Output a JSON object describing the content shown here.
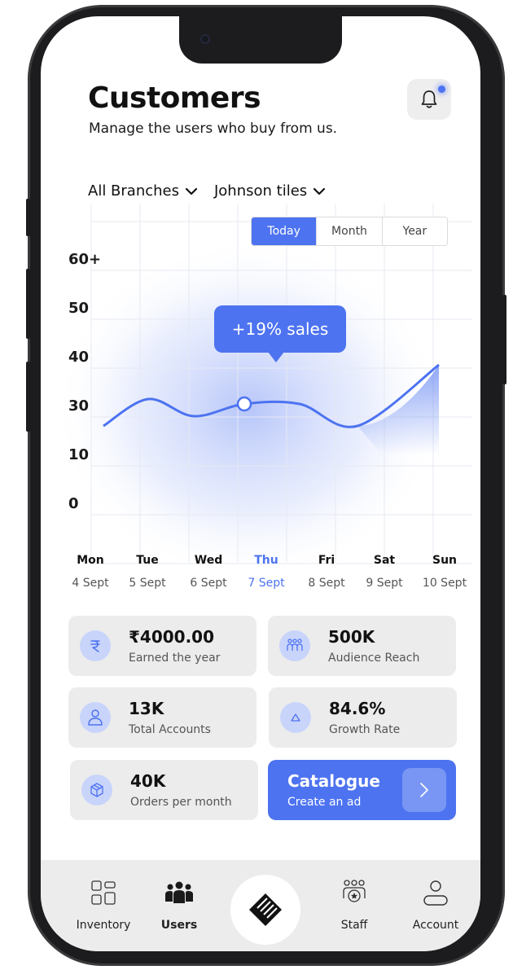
{
  "header": {
    "title": "Customers",
    "subtitle": "Manage the users who buy from us."
  },
  "filters": {
    "branch": "All Branches",
    "customer": "Johnson tiles"
  },
  "period_tabs": [
    "Today",
    "Month",
    "Year"
  ],
  "selected_period": "Today",
  "tooltip": "+19% sales",
  "chart_data": {
    "type": "line",
    "y_tick_labels": [
      "60+",
      "50",
      "40",
      "30",
      "10",
      "0"
    ],
    "x_days": [
      "Mon",
      "Tue",
      "Wed",
      "Thu",
      "Fri",
      "Sat",
      "Sun"
    ],
    "x_dates": [
      "4 Sept",
      "5 Sept",
      "6 Sept",
      "7 Sept",
      "8 Sept",
      "9 Sept",
      "10 Sept"
    ],
    "highlighted_index": 3,
    "series": [
      {
        "values": [
          25,
          33,
          29,
          32,
          32,
          25,
          40
        ]
      }
    ],
    "accent": "#4d73f0"
  },
  "stats": [
    {
      "value": "₹4000.00",
      "label": "Earned the year",
      "icon": "rupee-icon"
    },
    {
      "value": "500K",
      "label": "Audience Reach",
      "icon": "people-group-icon"
    },
    {
      "value": "13K",
      "label": "Total Accounts",
      "icon": "user-icon"
    },
    {
      "value": "84.6%",
      "label": "Growth Rate",
      "icon": "triangle-icon"
    },
    {
      "value": "40K",
      "label": "Orders per month",
      "icon": "box-icon"
    }
  ],
  "catalogue": {
    "title": "Catalogue",
    "subtitle": "Create an ad"
  },
  "tabs": [
    {
      "label": "Inventory",
      "icon": "grid-icon"
    },
    {
      "label": "Users",
      "icon": "users-icon"
    },
    {
      "label": "Staff",
      "icon": "staff-icon"
    },
    {
      "label": "Account",
      "icon": "account-icon"
    }
  ],
  "active_tab": "Users",
  "colors": {
    "accent": "#4d73f0",
    "card_bg": "#ececec"
  }
}
